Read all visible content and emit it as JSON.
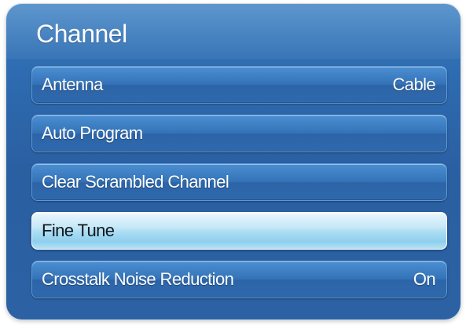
{
  "menu": {
    "title": "Channel",
    "items": [
      {
        "label": "Antenna",
        "value": "Cable"
      },
      {
        "label": "Auto Program",
        "value": ""
      },
      {
        "label": "Clear Scrambled Channel",
        "value": ""
      },
      {
        "label": "Fine Tune",
        "value": "",
        "selected": true
      },
      {
        "label": "Crosstalk Noise Reduction",
        "value": "On"
      }
    ]
  },
  "colors": {
    "panel_blue": "#2e6bb0",
    "item_blue": "#3573b8",
    "selected_highlight": "#a9dcf2"
  }
}
